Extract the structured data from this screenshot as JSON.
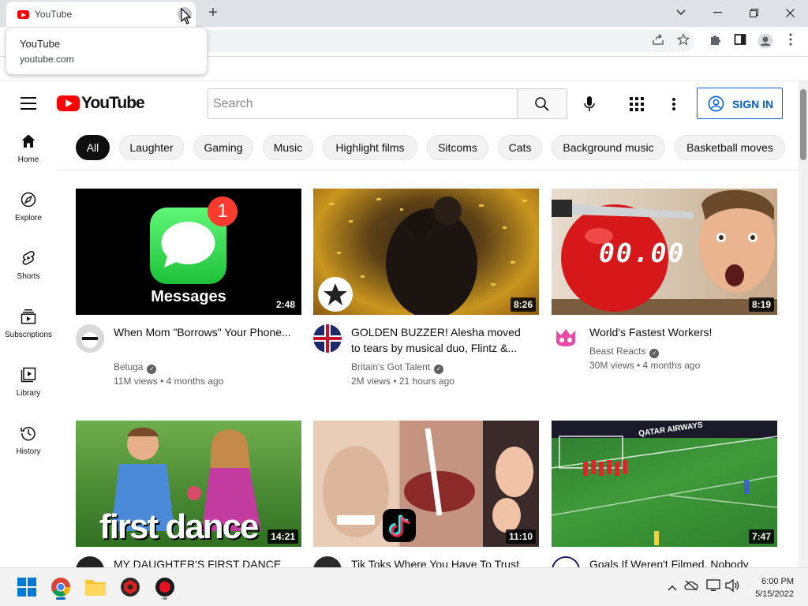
{
  "browser": {
    "tab_title": "YouTube",
    "tab_tooltip_title": "YouTube",
    "tab_tooltip_url": "youtube.com",
    "new_tab_symbol": "+",
    "close_tab_symbol": "×"
  },
  "masthead": {
    "logo_text": "YouTube",
    "search_placeholder": "Search",
    "sign_in_label": "SIGN IN"
  },
  "chips": [
    "All",
    "Laughter",
    "Gaming",
    "Music",
    "Highlight films",
    "Sitcoms",
    "Cats",
    "Background music",
    "Basketball moves"
  ],
  "guide": [
    {
      "label": "Home",
      "icon": "home-icon"
    },
    {
      "label": "Explore",
      "icon": "compass-icon"
    },
    {
      "label": "Shorts",
      "icon": "shorts-icon"
    },
    {
      "label": "Subscriptions",
      "icon": "subscriptions-icon"
    },
    {
      "label": "Library",
      "icon": "library-icon"
    },
    {
      "label": "History",
      "icon": "history-icon"
    }
  ],
  "videos": [
    {
      "title": "When Mom \"Borrows\" Your Phone...",
      "channel": "Beluga",
      "verified": true,
      "meta": "11M views • 4 months ago",
      "duration": "2:48",
      "thumb_text": "Messages",
      "badge": "1"
    },
    {
      "title": "GOLDEN BUZZER! Alesha moved to tears by musical duo, Flintz &...",
      "channel": "Britain's Got Talent",
      "verified": true,
      "meta": "2M views • 21 hours ago",
      "duration": "8:26"
    },
    {
      "title": "World's Fastest Workers!",
      "channel": "Beast Reacts",
      "verified": true,
      "meta": "30M views • 4 months ago",
      "duration": "8:19",
      "thumb_text": "00.00"
    },
    {
      "title": "MY DAUGHTER'S FIRST DANCE",
      "channel": "",
      "meta": "",
      "duration": "14:21",
      "thumb_text": "first dance"
    },
    {
      "title": "Tik Toks Where You Have To Trust",
      "channel": "",
      "meta": "",
      "duration": "11:10"
    },
    {
      "title": "Goals If Weren't Filmed, Nobody",
      "channel": "",
      "meta": "",
      "duration": "7:47",
      "thumb_text": "QATAR AIRWAYS"
    }
  ],
  "taskbar": {
    "time": "6:00 PM",
    "date": "5/15/2022"
  },
  "colors": {
    "brand_red": "#ff0000",
    "link_blue": "#065fd4",
    "chip_active": "#0f0f0f"
  }
}
